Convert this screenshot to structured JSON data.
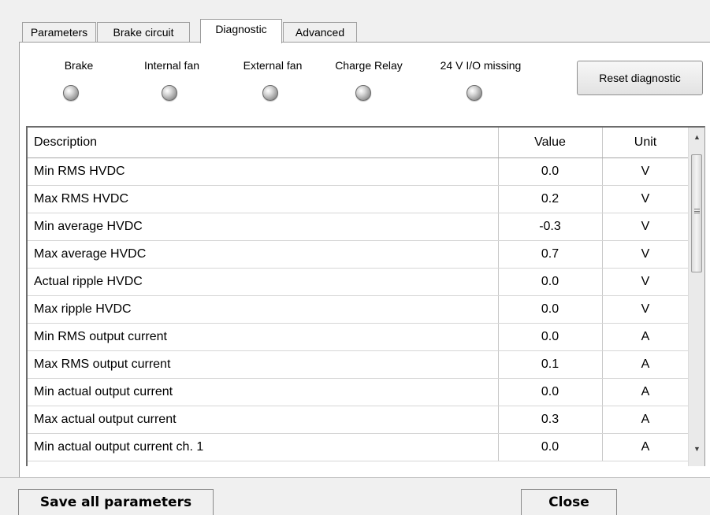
{
  "tabs": [
    {
      "label": "Parameters"
    },
    {
      "label": "Brake circuit"
    },
    {
      "label": "Diagnostic"
    },
    {
      "label": "Advanced"
    }
  ],
  "indicators": [
    {
      "label": "Brake"
    },
    {
      "label": "Internal fan"
    },
    {
      "label": "External fan"
    },
    {
      "label": "Charge Relay"
    },
    {
      "label": "24 V I/O missing"
    }
  ],
  "reset_label": "Reset diagnostic",
  "table": {
    "headers": {
      "description": "Description",
      "value": "Value",
      "unit": "Unit"
    },
    "rows": [
      {
        "description": "Min RMS HVDC",
        "value": "0.0",
        "unit": "V"
      },
      {
        "description": "Max RMS HVDC",
        "value": "0.2",
        "unit": "V"
      },
      {
        "description": "Min average HVDC",
        "value": "-0.3",
        "unit": "V"
      },
      {
        "description": "Max average HVDC",
        "value": "0.7",
        "unit": "V"
      },
      {
        "description": "Actual ripple HVDC",
        "value": "0.0",
        "unit": "V"
      },
      {
        "description": "Max ripple HVDC",
        "value": "0.0",
        "unit": "V"
      },
      {
        "description": "Min RMS output current",
        "value": "0.0",
        "unit": "A"
      },
      {
        "description": "Max RMS output current",
        "value": "0.1",
        "unit": "A"
      },
      {
        "description": "Min actual output current",
        "value": "0.0",
        "unit": "A"
      },
      {
        "description": "Max actual output current",
        "value": "0.3",
        "unit": "A"
      },
      {
        "description": "Min actual output current ch. 1",
        "value": "0.0",
        "unit": "A"
      }
    ]
  },
  "buttons": {
    "save_all": "Save all parameters",
    "close": "Close"
  },
  "scrollbar": {
    "up_icon": "▲",
    "down_icon": "▼"
  }
}
